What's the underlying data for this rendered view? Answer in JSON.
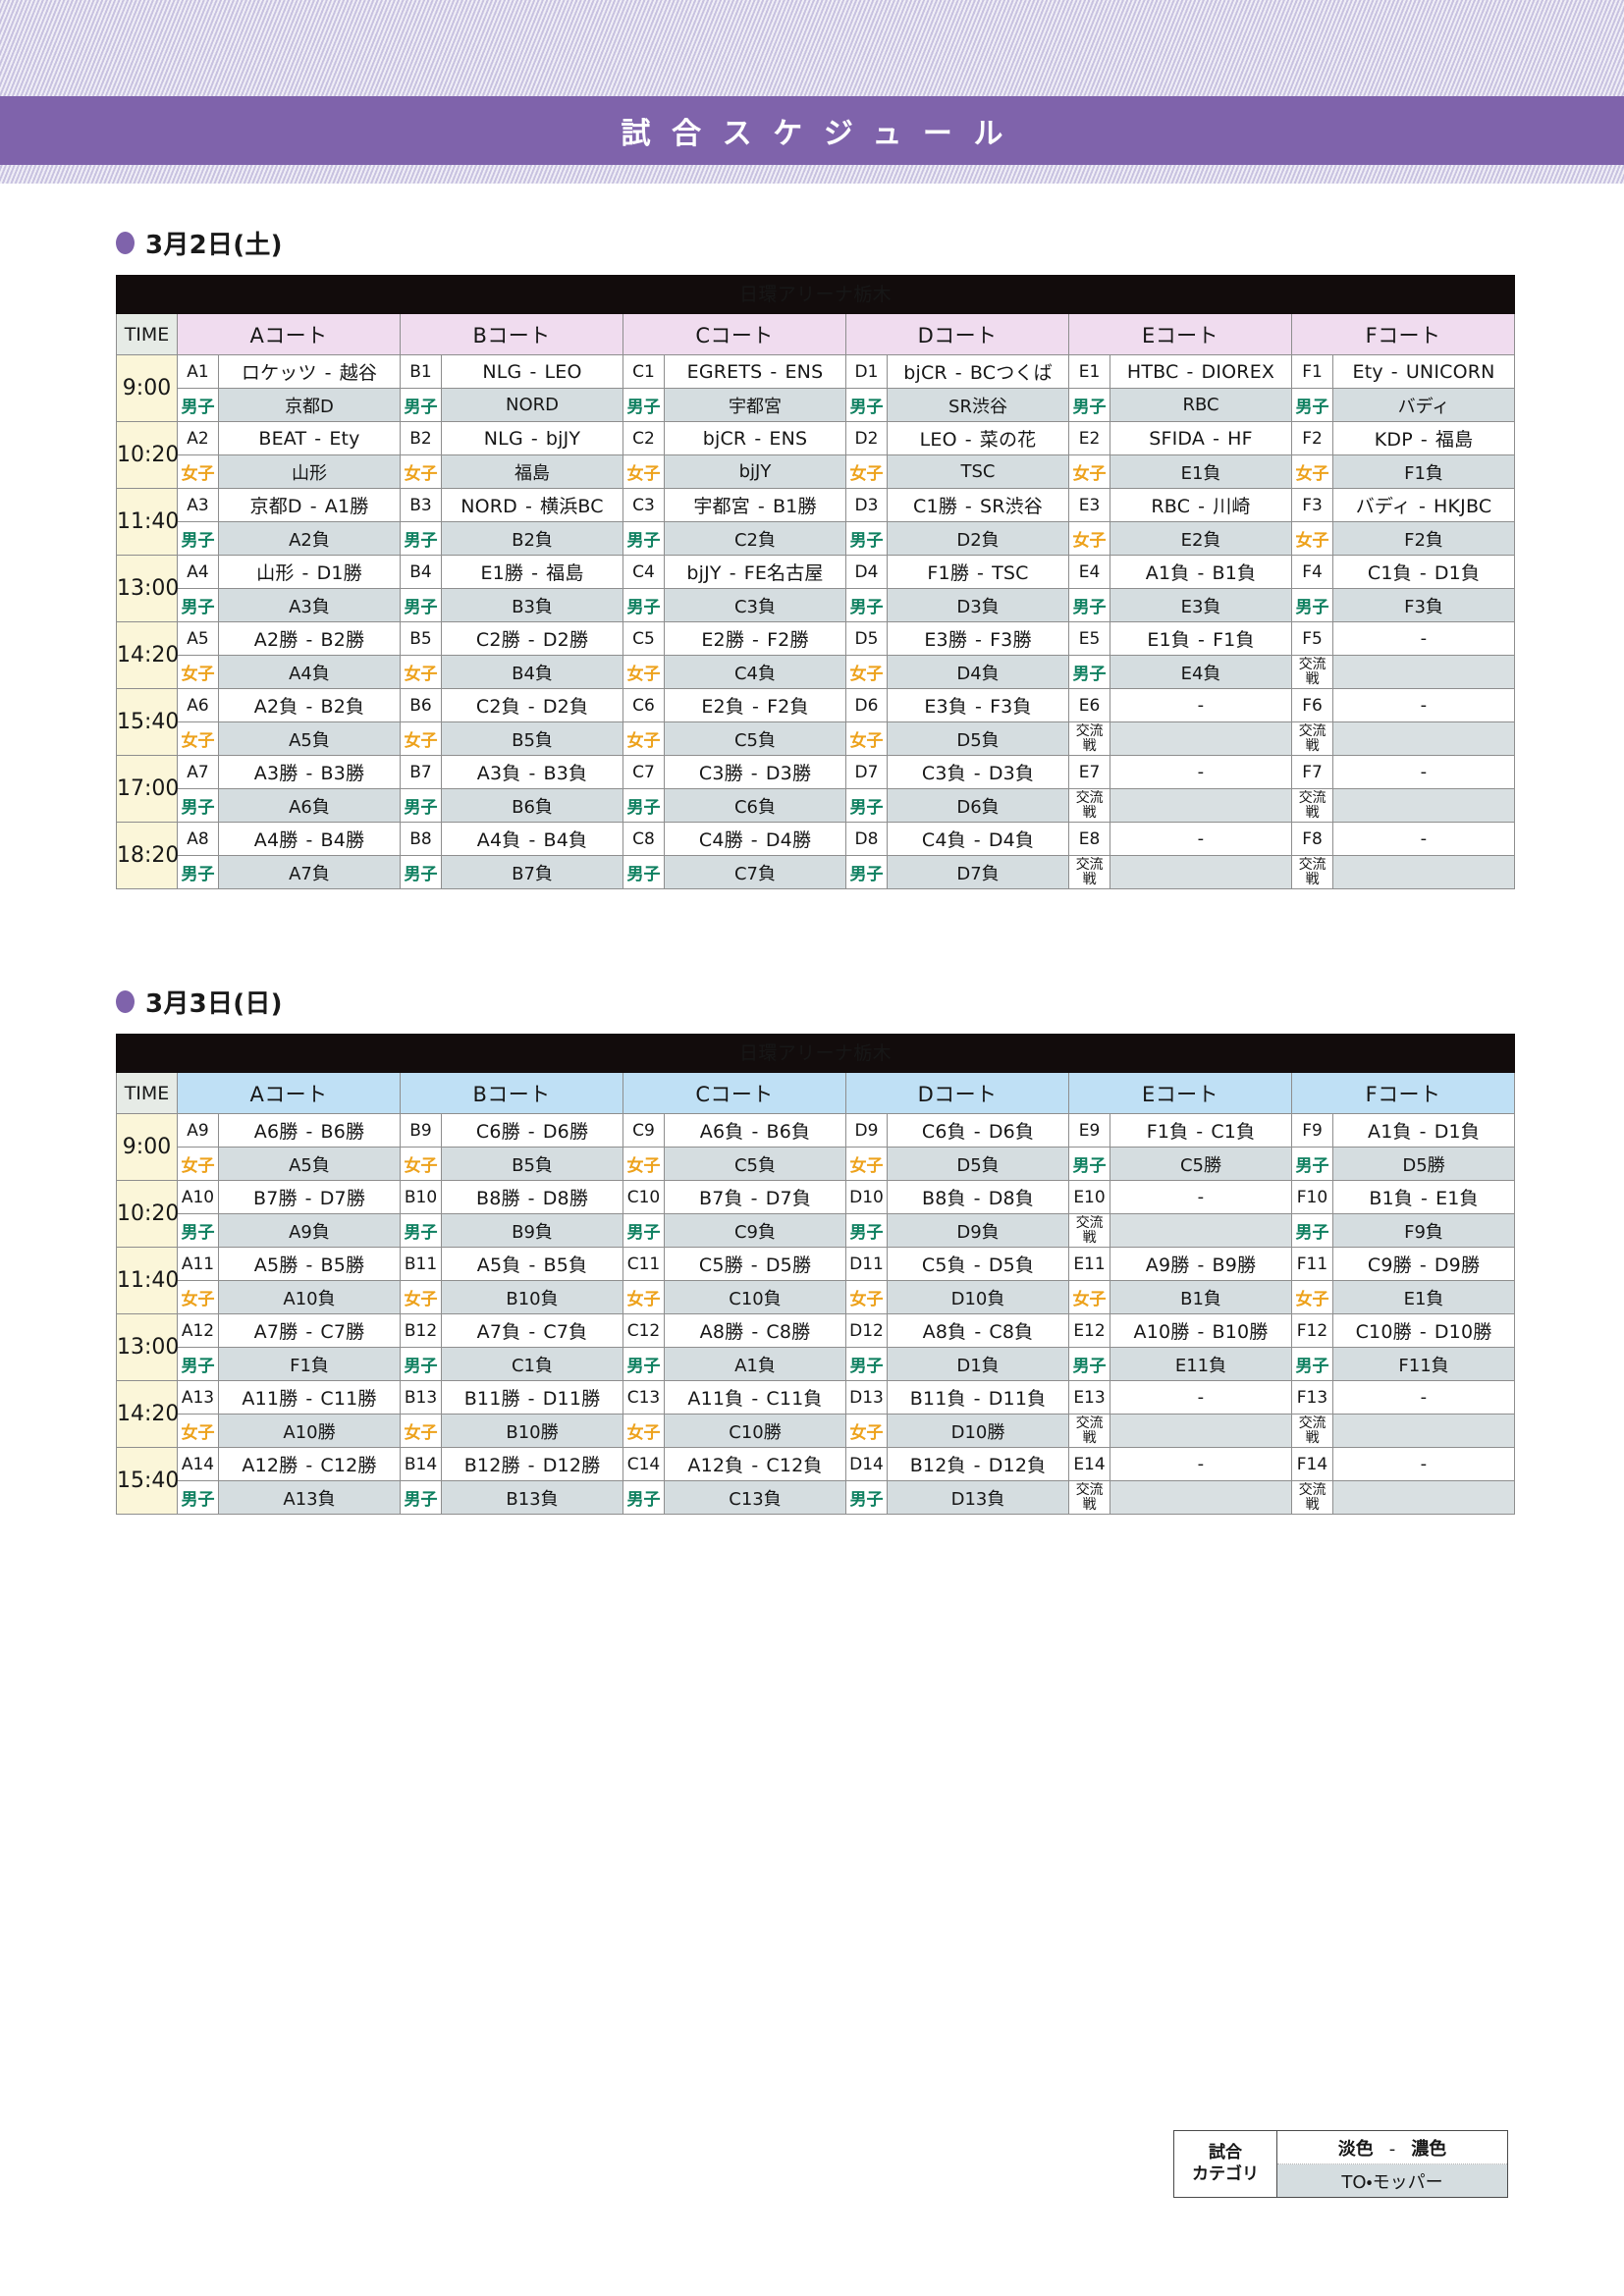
{
  "banner": {
    "title": "試合スケジュール"
  },
  "legend": {
    "label_line1": "試合",
    "label_line2": "カテゴリ",
    "light": "淡色",
    "sep": "-",
    "dark": "濃色",
    "to_mopper": "TO・モッパー"
  },
  "common": {
    "time_header": "TIME",
    "venue": "日環アリーナ栃木",
    "courts": [
      "Aコート",
      "Bコート",
      "Cコート",
      "Dコート",
      "Eコート",
      "Fコート"
    ],
    "cat_men": "男子",
    "cat_women": "女子",
    "cat_exchange_1": "交流",
    "cat_exchange_2": "戦",
    "dash": "-",
    "empty": "-"
  },
  "days": [
    {
      "label": "3月2日(土)",
      "venue": "日環アリーナ栃木",
      "header_color": "#f0dcef",
      "rows": [
        {
          "time": "9:00",
          "cells": [
            {
              "id": "A1",
              "cat": "男子",
              "home": "ロケッツ",
              "away": "越谷",
              "to": "京都D"
            },
            {
              "id": "B1",
              "cat": "男子",
              "home": "NLG",
              "away": "LEO",
              "to": "NORD"
            },
            {
              "id": "C1",
              "cat": "男子",
              "home": "EGRETS",
              "away": "ENS",
              "to": "宇都宮"
            },
            {
              "id": "D1",
              "cat": "男子",
              "home": "bjCR",
              "away": "BCつくば",
              "to": "SR渋谷"
            },
            {
              "id": "E1",
              "cat": "男子",
              "home": "HTBC",
              "away": "DIOREX",
              "to": "RBC"
            },
            {
              "id": "F1",
              "cat": "男子",
              "home": "Ety",
              "away": "UNICORN",
              "to": "バディ"
            }
          ]
        },
        {
          "time": "10:20",
          "cells": [
            {
              "id": "A2",
              "cat": "女子",
              "home": "BEAT",
              "away": "Ety",
              "to": "山形"
            },
            {
              "id": "B2",
              "cat": "女子",
              "home": "NLG",
              "away": "bjJY",
              "to": "福島"
            },
            {
              "id": "C2",
              "cat": "女子",
              "home": "bjCR",
              "away": "ENS",
              "to": "bjJY"
            },
            {
              "id": "D2",
              "cat": "女子",
              "home": "LEO",
              "away": "菜の花",
              "to": "TSC"
            },
            {
              "id": "E2",
              "cat": "女子",
              "home": "SFIDA",
              "away": "HF",
              "to": "E1負"
            },
            {
              "id": "F2",
              "cat": "女子",
              "home": "KDP",
              "away": "福島",
              "to": "F1負"
            }
          ]
        },
        {
          "time": "11:40",
          "cells": [
            {
              "id": "A3",
              "cat": "男子",
              "home": "京都D",
              "away": "A1勝",
              "to": "A2負"
            },
            {
              "id": "B3",
              "cat": "男子",
              "home": "NORD",
              "away": "横浜BC",
              "to": "B2負"
            },
            {
              "id": "C3",
              "cat": "男子",
              "home": "宇都宮",
              "away": "B1勝",
              "to": "C2負"
            },
            {
              "id": "D3",
              "cat": "男子",
              "home": "C1勝",
              "away": "SR渋谷",
              "to": "D2負"
            },
            {
              "id": "E3",
              "cat": "女子",
              "home": "RBC",
              "away": "川崎",
              "to": "E2負"
            },
            {
              "id": "F3",
              "cat": "女子",
              "home": "バディ",
              "away": "HKJBC",
              "to": "F2負"
            }
          ]
        },
        {
          "time": "13:00",
          "cells": [
            {
              "id": "A4",
              "cat": "男子",
              "home": "山形",
              "away": "D1勝",
              "to": "A3負"
            },
            {
              "id": "B4",
              "cat": "男子",
              "home": "E1勝",
              "away": "福島",
              "to": "B3負"
            },
            {
              "id": "C4",
              "cat": "男子",
              "home": "bjJY",
              "away": "FE名古屋",
              "to": "C3負"
            },
            {
              "id": "D4",
              "cat": "男子",
              "home": "F1勝",
              "away": "TSC",
              "to": "D3負"
            },
            {
              "id": "E4",
              "cat": "男子",
              "home": "A1負",
              "away": "B1負",
              "to": "E3負"
            },
            {
              "id": "F4",
              "cat": "男子",
              "home": "C1負",
              "away": "D1負",
              "to": "F3負"
            }
          ]
        },
        {
          "time": "14:20",
          "cells": [
            {
              "id": "A5",
              "cat": "女子",
              "home": "A2勝",
              "away": "B2勝",
              "to": "A4負"
            },
            {
              "id": "B5",
              "cat": "女子",
              "home": "C2勝",
              "away": "D2勝",
              "to": "B4負"
            },
            {
              "id": "C5",
              "cat": "女子",
              "home": "E2勝",
              "away": "F2勝",
              "to": "C4負"
            },
            {
              "id": "D5",
              "cat": "女子",
              "home": "E3勝",
              "away": "F3勝",
              "to": "D4負"
            },
            {
              "id": "E5",
              "cat": "男子",
              "home": "E1負",
              "away": "F1負",
              "to": "E4負"
            },
            {
              "id": "F5",
              "cat": "交流戦",
              "home": "",
              "away": "",
              "to": ""
            }
          ]
        },
        {
          "time": "15:40",
          "cells": [
            {
              "id": "A6",
              "cat": "女子",
              "home": "A2負",
              "away": "B2負",
              "to": "A5負"
            },
            {
              "id": "B6",
              "cat": "女子",
              "home": "C2負",
              "away": "D2負",
              "to": "B5負"
            },
            {
              "id": "C6",
              "cat": "女子",
              "home": "E2負",
              "away": "F2負",
              "to": "C5負"
            },
            {
              "id": "D6",
              "cat": "女子",
              "home": "E3負",
              "away": "F3負",
              "to": "D5負"
            },
            {
              "id": "E6",
              "cat": "交流戦",
              "home": "",
              "away": "",
              "to": ""
            },
            {
              "id": "F6",
              "cat": "交流戦",
              "home": "",
              "away": "",
              "to": ""
            }
          ]
        },
        {
          "time": "17:00",
          "cells": [
            {
              "id": "A7",
              "cat": "男子",
              "home": "A3勝",
              "away": "B3勝",
              "to": "A6負"
            },
            {
              "id": "B7",
              "cat": "男子",
              "home": "A3負",
              "away": "B3負",
              "to": "B6負"
            },
            {
              "id": "C7",
              "cat": "男子",
              "home": "C3勝",
              "away": "D3勝",
              "to": "C6負"
            },
            {
              "id": "D7",
              "cat": "男子",
              "home": "C3負",
              "away": "D3負",
              "to": "D6負"
            },
            {
              "id": "E7",
              "cat": "交流戦",
              "home": "",
              "away": "",
              "to": ""
            },
            {
              "id": "F7",
              "cat": "交流戦",
              "home": "",
              "away": "",
              "to": ""
            }
          ]
        },
        {
          "time": "18:20",
          "cells": [
            {
              "id": "A8",
              "cat": "男子",
              "home": "A4勝",
              "away": "B4勝",
              "to": "A7負"
            },
            {
              "id": "B8",
              "cat": "男子",
              "home": "A4負",
              "away": "B4負",
              "to": "B7負"
            },
            {
              "id": "C8",
              "cat": "男子",
              "home": "C4勝",
              "away": "D4勝",
              "to": "C7負"
            },
            {
              "id": "D8",
              "cat": "男子",
              "home": "C4負",
              "away": "D4負",
              "to": "D7負"
            },
            {
              "id": "E8",
              "cat": "交流戦",
              "home": "",
              "away": "",
              "to": ""
            },
            {
              "id": "F8",
              "cat": "交流戦",
              "home": "",
              "away": "",
              "to": ""
            }
          ]
        }
      ]
    },
    {
      "label": "3月3日(日)",
      "venue": "日環アリーナ栃木",
      "header_color": "#bfe0f5",
      "rows": [
        {
          "time": "9:00",
          "cells": [
            {
              "id": "A9",
              "cat": "女子",
              "home": "A6勝",
              "away": "B6勝",
              "to": "A5負"
            },
            {
              "id": "B9",
              "cat": "女子",
              "home": "C6勝",
              "away": "D6勝",
              "to": "B5負"
            },
            {
              "id": "C9",
              "cat": "女子",
              "home": "A6負",
              "away": "B6負",
              "to": "C5負"
            },
            {
              "id": "D9",
              "cat": "女子",
              "home": "C6負",
              "away": "D6負",
              "to": "D5負"
            },
            {
              "id": "E9",
              "cat": "男子",
              "home": "F1負",
              "away": "C1負",
              "to": "C5勝"
            },
            {
              "id": "F9",
              "cat": "男子",
              "home": "A1負",
              "away": "D1負",
              "to": "D5勝"
            }
          ]
        },
        {
          "time": "10:20",
          "cells": [
            {
              "id": "A10",
              "cat": "男子",
              "home": "B7勝",
              "away": "D7勝",
              "to": "A9負"
            },
            {
              "id": "B10",
              "cat": "男子",
              "home": "B8勝",
              "away": "D8勝",
              "to": "B9負"
            },
            {
              "id": "C10",
              "cat": "男子",
              "home": "B7負",
              "away": "D7負",
              "to": "C9負"
            },
            {
              "id": "D10",
              "cat": "男子",
              "home": "B8負",
              "away": "D8負",
              "to": "D9負"
            },
            {
              "id": "E10",
              "cat": "交流戦",
              "home": "",
              "away": "",
              "to": ""
            },
            {
              "id": "F10",
              "cat": "男子",
              "home": "B1負",
              "away": "E1負",
              "to": "F9負"
            }
          ]
        },
        {
          "time": "11:40",
          "cells": [
            {
              "id": "A11",
              "cat": "女子",
              "home": "A5勝",
              "away": "B5勝",
              "to": "A10負"
            },
            {
              "id": "B11",
              "cat": "女子",
              "home": "A5負",
              "away": "B5負",
              "to": "B10負"
            },
            {
              "id": "C11",
              "cat": "女子",
              "home": "C5勝",
              "away": "D5勝",
              "to": "C10負"
            },
            {
              "id": "D11",
              "cat": "女子",
              "home": "C5負",
              "away": "D5負",
              "to": "D10負"
            },
            {
              "id": "E11",
              "cat": "女子",
              "home": "A9勝",
              "away": "B9勝",
              "to": "B1負"
            },
            {
              "id": "F11",
              "cat": "女子",
              "home": "C9勝",
              "away": "D9勝",
              "to": "E1負"
            }
          ]
        },
        {
          "time": "13:00",
          "cells": [
            {
              "id": "A12",
              "cat": "男子",
              "home": "A7勝",
              "away": "C7勝",
              "to": "F1負"
            },
            {
              "id": "B12",
              "cat": "男子",
              "home": "A7負",
              "away": "C7負",
              "to": "C1負"
            },
            {
              "id": "C12",
              "cat": "男子",
              "home": "A8勝",
              "away": "C8勝",
              "to": "A1負"
            },
            {
              "id": "D12",
              "cat": "男子",
              "home": "A8負",
              "away": "C8負",
              "to": "D1負"
            },
            {
              "id": "E12",
              "cat": "男子",
              "home": "A10勝",
              "away": "B10勝",
              "to": "E11負"
            },
            {
              "id": "F12",
              "cat": "男子",
              "home": "C10勝",
              "away": "D10勝",
              "to": "F11負"
            }
          ]
        },
        {
          "time": "14:20",
          "cells": [
            {
              "id": "A13",
              "cat": "女子",
              "home": "A11勝",
              "away": "C11勝",
              "to": "A10勝"
            },
            {
              "id": "B13",
              "cat": "女子",
              "home": "B11勝",
              "away": "D11勝",
              "to": "B10勝"
            },
            {
              "id": "C13",
              "cat": "女子",
              "home": "A11負",
              "away": "C11負",
              "to": "C10勝"
            },
            {
              "id": "D13",
              "cat": "女子",
              "home": "B11負",
              "away": "D11負",
              "to": "D10勝"
            },
            {
              "id": "E13",
              "cat": "交流戦",
              "home": "",
              "away": "",
              "to": ""
            },
            {
              "id": "F13",
              "cat": "交流戦",
              "home": "",
              "away": "",
              "to": ""
            }
          ]
        },
        {
          "time": "15:40",
          "cells": [
            {
              "id": "A14",
              "cat": "男子",
              "home": "A12勝",
              "away": "C12勝",
              "to": "A13負"
            },
            {
              "id": "B14",
              "cat": "男子",
              "home": "B12勝",
              "away": "D12勝",
              "to": "B13負"
            },
            {
              "id": "C14",
              "cat": "男子",
              "home": "A12負",
              "away": "C12負",
              "to": "C13負"
            },
            {
              "id": "D14",
              "cat": "男子",
              "home": "B12負",
              "away": "D12負",
              "to": "D13負"
            },
            {
              "id": "E14",
              "cat": "交流戦",
              "home": "",
              "away": "",
              "to": ""
            },
            {
              "id": "F14",
              "cat": "交流戦",
              "home": "",
              "away": "",
              "to": ""
            }
          ]
        }
      ]
    }
  ]
}
